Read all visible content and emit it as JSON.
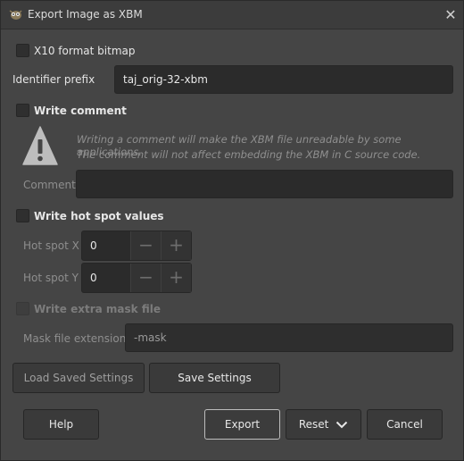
{
  "window": {
    "title": "Export Image as XBM",
    "close_symbol": "✕",
    "icon": "gimp-icon"
  },
  "x10": {
    "label": "X10 format bitmap",
    "checked": false
  },
  "identifier": {
    "label": "Identifier prefix",
    "value": "taj_orig-32-xbm"
  },
  "comment": {
    "checkbox_label": "Write comment",
    "checked": false,
    "warning_icon": "warning-icon",
    "warning_line1": "Writing a comment will make the XBM file unreadable by some applications.",
    "warning_line2": "The comment will not affect embedding the XBM in C source code.",
    "field_label": "Comment",
    "value": ""
  },
  "hotspot": {
    "checkbox_label": "Write hot spot values",
    "checked": false,
    "x_label": "Hot spot X",
    "x_value": "0",
    "y_label": "Hot spot Y",
    "y_value": "0",
    "minus": "−",
    "plus": "+"
  },
  "mask": {
    "checkbox_label": "Write extra mask file",
    "checked": false,
    "ext_label": "Mask file extensions",
    "ext_value": "-mask"
  },
  "settings": {
    "load_label": "Load Saved Settings",
    "save_label": "Save Settings"
  },
  "actions": {
    "help_label": "Help",
    "export_label": "Export",
    "reset_label": "Reset",
    "cancel_label": "Cancel"
  },
  "colors": {
    "background": "#454545",
    "entry_bg": "#2b2b2b",
    "dim_text": "#8f8f8f"
  }
}
